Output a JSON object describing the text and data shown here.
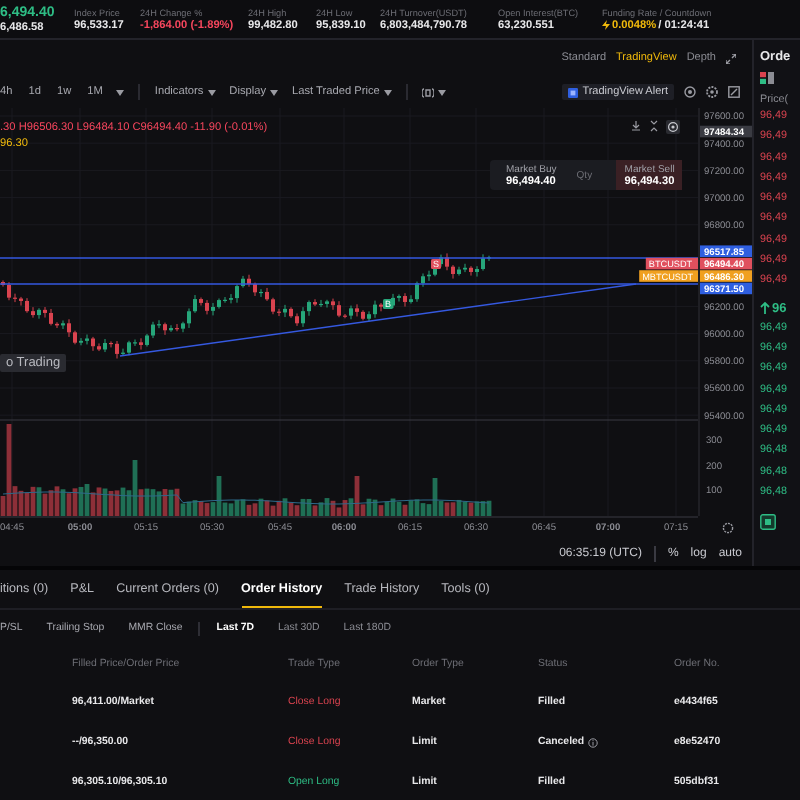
{
  "ticker": {
    "last_price": "6,494.40",
    "mark_price": "6,486.58"
  },
  "stats": [
    {
      "kind": "plain",
      "label": "Index Price",
      "value": "96,533.17"
    },
    {
      "kind": "plain",
      "label": "24H Change %",
      "value": "-1,864.00 (-1.89%)",
      "color": "#f6465d"
    },
    {
      "kind": "plain",
      "label": "24H High",
      "value": "99,482.80"
    },
    {
      "kind": "plain",
      "label": "24H Low",
      "value": "95,839.10"
    },
    {
      "kind": "plain",
      "label": "24H Turnover(USDT)",
      "value": "6,803,484,790.78"
    },
    {
      "kind": "plain",
      "label": "Open Interest(BTC)",
      "value": "63,230.551"
    },
    {
      "kind": "funding",
      "label": "Funding Rate / Countdown",
      "rate": "0.0048%",
      "countdown": "/ 01:24:41"
    }
  ],
  "chart_views": [
    {
      "label": "Standard",
      "selected": false
    },
    {
      "label": "TradingView",
      "selected": true
    },
    {
      "label": "Depth",
      "selected": false
    }
  ],
  "intervals": [
    "4h",
    "1d",
    "1w",
    "1M"
  ],
  "menus": [
    "Indicators",
    "Display",
    "Last Traded Price"
  ],
  "alert_button": "TradingView Alert",
  "ohlc": ".30 H96506.30 L96484.10 C96494.40 -11.90 (-0.01%)",
  "open_price": "96.30",
  "chart_label": "o Trading",
  "market_box": {
    "buy_label": "Market Buy",
    "buy_price": "96,494.40",
    "qty_placeholder": "Qty",
    "sell_label": "Market Sell",
    "sell_price": "96,494.30"
  },
  "price_axis": [
    {
      "label": "97600.00"
    },
    {
      "label": "97484.34",
      "color": "#3a3b42"
    },
    {
      "label": "97400.00"
    },
    {
      "label": "97200.00"
    },
    {
      "label": "97000.00"
    },
    {
      "label": "96800.00"
    },
    {
      "label": "96517.85",
      "color": "#2f5fe0"
    },
    {
      "label": "96494.40",
      "color": "#e0505e",
      "symbol": "BTCUSDT"
    },
    {
      "label": "96486.30",
      "color": "#f0a020",
      "symbol": "MBTCUSDT"
    },
    {
      "label": "96371.50",
      "color": "#2f5fe0"
    },
    {
      "label": "96200.00"
    },
    {
      "label": "96000.00"
    },
    {
      "label": "95800.00"
    },
    {
      "label": "95600.00"
    },
    {
      "label": "95400.00"
    }
  ],
  "volume_axis": [
    "300",
    "200",
    "100"
  ],
  "time_axis": [
    "04:45",
    "05:00",
    "05:15",
    "05:30",
    "05:45",
    "06:00",
    "06:15",
    "06:30",
    "06:45",
    "07:00",
    "07:15"
  ],
  "markers": [
    {
      "label": "S",
      "kind": "sell"
    },
    {
      "label": "B",
      "kind": "buy"
    }
  ],
  "status": {
    "clock": "06:35:19 (UTC)",
    "options": [
      "%",
      "log",
      "auto"
    ]
  },
  "order_book": {
    "title": "Orde",
    "price_header": "Price(",
    "last": "96",
    "asks": [
      "96,49",
      "96,49",
      "96,49",
      "96,49",
      "96,49",
      "96,49",
      "96,49",
      "96,49",
      "96,49"
    ],
    "bids": [
      "96,49",
      "96,49",
      "96,49",
      "96,49",
      "96,49",
      "96,49",
      "96,48",
      "96,48",
      "96,48"
    ]
  },
  "tabs": [
    {
      "label": "itions (0)",
      "selected": false
    },
    {
      "label": "P&L",
      "selected": false
    },
    {
      "label": "Current Orders (0)",
      "selected": false
    },
    {
      "label": "Order History",
      "selected": true
    },
    {
      "label": "Trade History",
      "selected": false
    },
    {
      "label": "Tools (0)",
      "selected": false
    }
  ],
  "filters": [
    "P/SL",
    "Trailing Stop",
    "MMR Close"
  ],
  "periods": [
    {
      "label": "Last 7D",
      "selected": true
    },
    {
      "label": "Last 30D",
      "selected": false
    },
    {
      "label": "Last 180D",
      "selected": false
    }
  ],
  "table": {
    "columns": [
      "Filled Price/Order Price",
      "Trade Type",
      "Order Type",
      "Status",
      "Order No."
    ],
    "rows": [
      {
        "price": "96,411.00/Market",
        "trade_type": "Close Long",
        "kind": "close",
        "order_type": "Market",
        "status": "Filled",
        "info": false,
        "order_no": "e4434f65"
      },
      {
        "price": "--/96,350.00",
        "trade_type": "Close Long",
        "kind": "close",
        "order_type": "Limit",
        "status": "Canceled",
        "info": true,
        "order_no": "e8e52470"
      },
      {
        "price": "96,305.10/96,305.10",
        "trade_type": "Open Long",
        "kind": "open",
        "order_type": "Limit",
        "status": "Filled",
        "info": false,
        "order_no": "505dbf31"
      }
    ]
  }
}
